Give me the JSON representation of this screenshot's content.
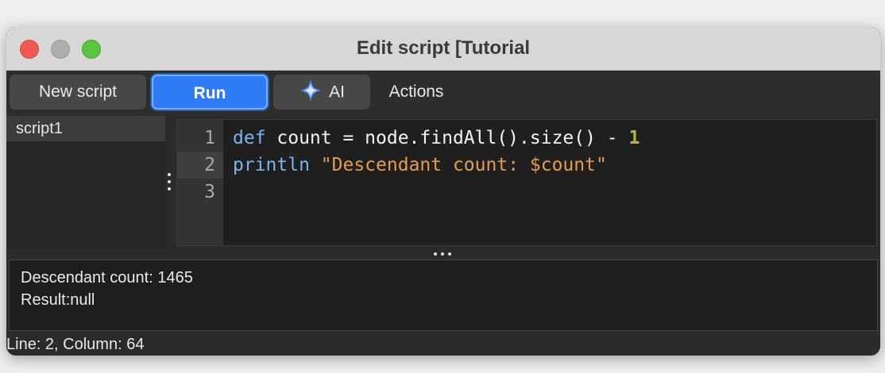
{
  "window": {
    "title": "Edit script [Tutorial"
  },
  "toolbar": {
    "new_script_label": "New script",
    "run_label": "Run",
    "ai_label": "AI",
    "actions_label": "Actions"
  },
  "sidebar": {
    "items": [
      {
        "label": "script1",
        "selected": true
      }
    ]
  },
  "editor": {
    "line_numbers": [
      "1",
      "2",
      "3"
    ],
    "current_line": 2,
    "lines": [
      {
        "tokens": [
          {
            "text": "def",
            "kind": "keyword"
          },
          {
            "text": " count = node.findAll().size() - ",
            "kind": "plain"
          },
          {
            "text": "1",
            "kind": "number"
          }
        ]
      },
      {
        "tokens": [
          {
            "text": "println",
            "kind": "keyword"
          },
          {
            "text": " ",
            "kind": "plain"
          },
          {
            "text": "\"Descendant count: $count\"",
            "kind": "string"
          }
        ]
      },
      {
        "tokens": []
      }
    ]
  },
  "output": {
    "lines": [
      "Descendant count: 1465",
      "Result:null"
    ]
  },
  "status": {
    "text": "Line: 2, Column: 64"
  },
  "colors": {
    "run_button": "#2f7bf6",
    "keyword": "#7cb2f0",
    "string": "#e59a52",
    "number": "#b5b54a",
    "ai_icon": "#4f8ff7"
  },
  "icons": {
    "ai": "sparkle-icon"
  }
}
